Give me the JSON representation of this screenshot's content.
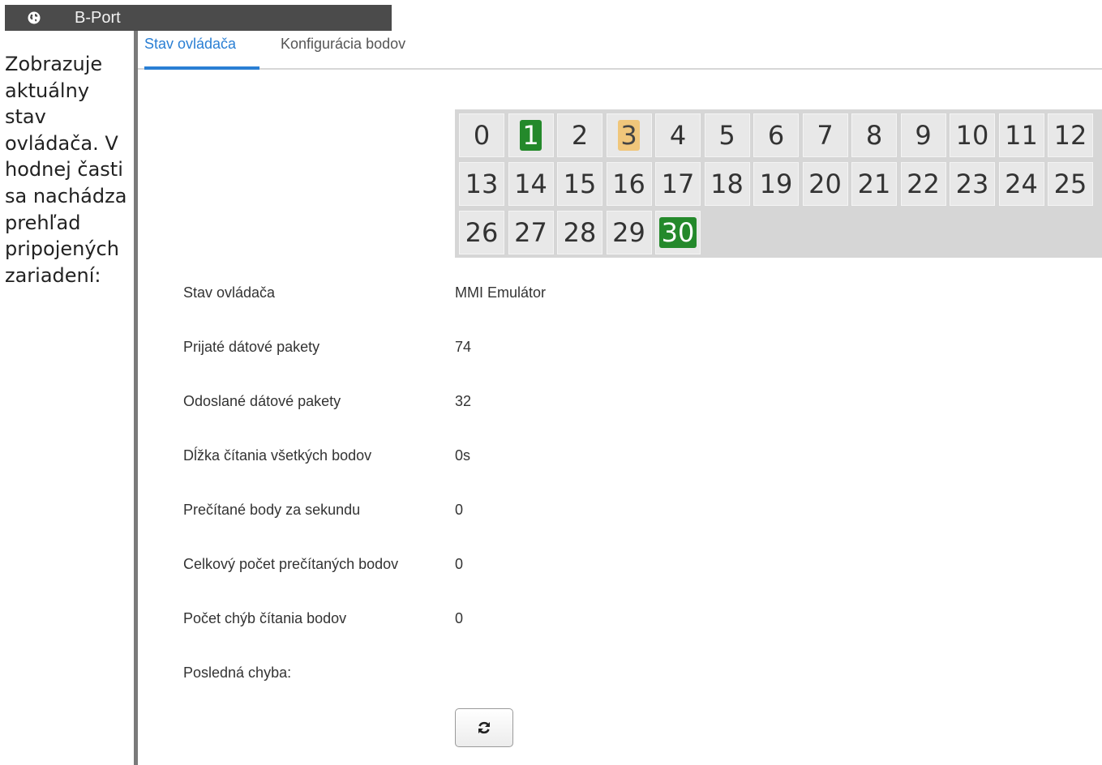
{
  "window": {
    "title": "B-Port",
    "icon": "globe-icon"
  },
  "doc_text": "Zobrazuje aktuálny stav ovládača. V hodnej časti sa nachádza prehľad pripojených zariadení:",
  "tabs": [
    {
      "label": "Stav ovládača",
      "active": true
    },
    {
      "label": "Konfigurácia bodov",
      "active": false
    }
  ],
  "devices": [
    {
      "id": "0",
      "state": "normal"
    },
    {
      "id": "1",
      "state": "ok"
    },
    {
      "id": "2",
      "state": "normal"
    },
    {
      "id": "3",
      "state": "warn"
    },
    {
      "id": "4",
      "state": "normal"
    },
    {
      "id": "5",
      "state": "normal"
    },
    {
      "id": "6",
      "state": "normal"
    },
    {
      "id": "7",
      "state": "normal"
    },
    {
      "id": "8",
      "state": "normal"
    },
    {
      "id": "9",
      "state": "normal"
    },
    {
      "id": "10",
      "state": "normal"
    },
    {
      "id": "11",
      "state": "normal"
    },
    {
      "id": "12",
      "state": "normal"
    },
    {
      "id": "13",
      "state": "normal"
    },
    {
      "id": "14",
      "state": "normal"
    },
    {
      "id": "15",
      "state": "normal"
    },
    {
      "id": "16",
      "state": "normal"
    },
    {
      "id": "17",
      "state": "normal"
    },
    {
      "id": "18",
      "state": "normal"
    },
    {
      "id": "19",
      "state": "normal"
    },
    {
      "id": "20",
      "state": "normal"
    },
    {
      "id": "21",
      "state": "normal"
    },
    {
      "id": "22",
      "state": "normal"
    },
    {
      "id": "23",
      "state": "normal"
    },
    {
      "id": "24",
      "state": "normal"
    },
    {
      "id": "25",
      "state": "normal"
    },
    {
      "id": "26",
      "state": "normal"
    },
    {
      "id": "27",
      "state": "normal"
    },
    {
      "id": "28",
      "state": "normal"
    },
    {
      "id": "29",
      "state": "normal"
    },
    {
      "id": "30",
      "state": "ok"
    }
  ],
  "stats": [
    {
      "label": "Stav ovládača",
      "value": "MMI Emulátor"
    },
    {
      "label": "Prijaté dátové pakety",
      "value": "74"
    },
    {
      "label": "Odoslané dátové pakety",
      "value": "32"
    },
    {
      "label": "Dĺžka čítania všetkých bodov",
      "value": "0s"
    },
    {
      "label": "Prečítané body za sekundu",
      "value": "0"
    },
    {
      "label": "Celkový počet prečítaných bodov",
      "value": "0"
    },
    {
      "label": "Počet chýb čítania bodov",
      "value": "0"
    },
    {
      "label": "Posledná chyba:",
      "value": ""
    }
  ],
  "refresh_button": {
    "icon": "refresh-icon"
  },
  "colors": {
    "accent": "#2a7fd4",
    "ok": "#24892b",
    "warn": "#f0c67b",
    "titlebar": "#4b4b4b"
  }
}
